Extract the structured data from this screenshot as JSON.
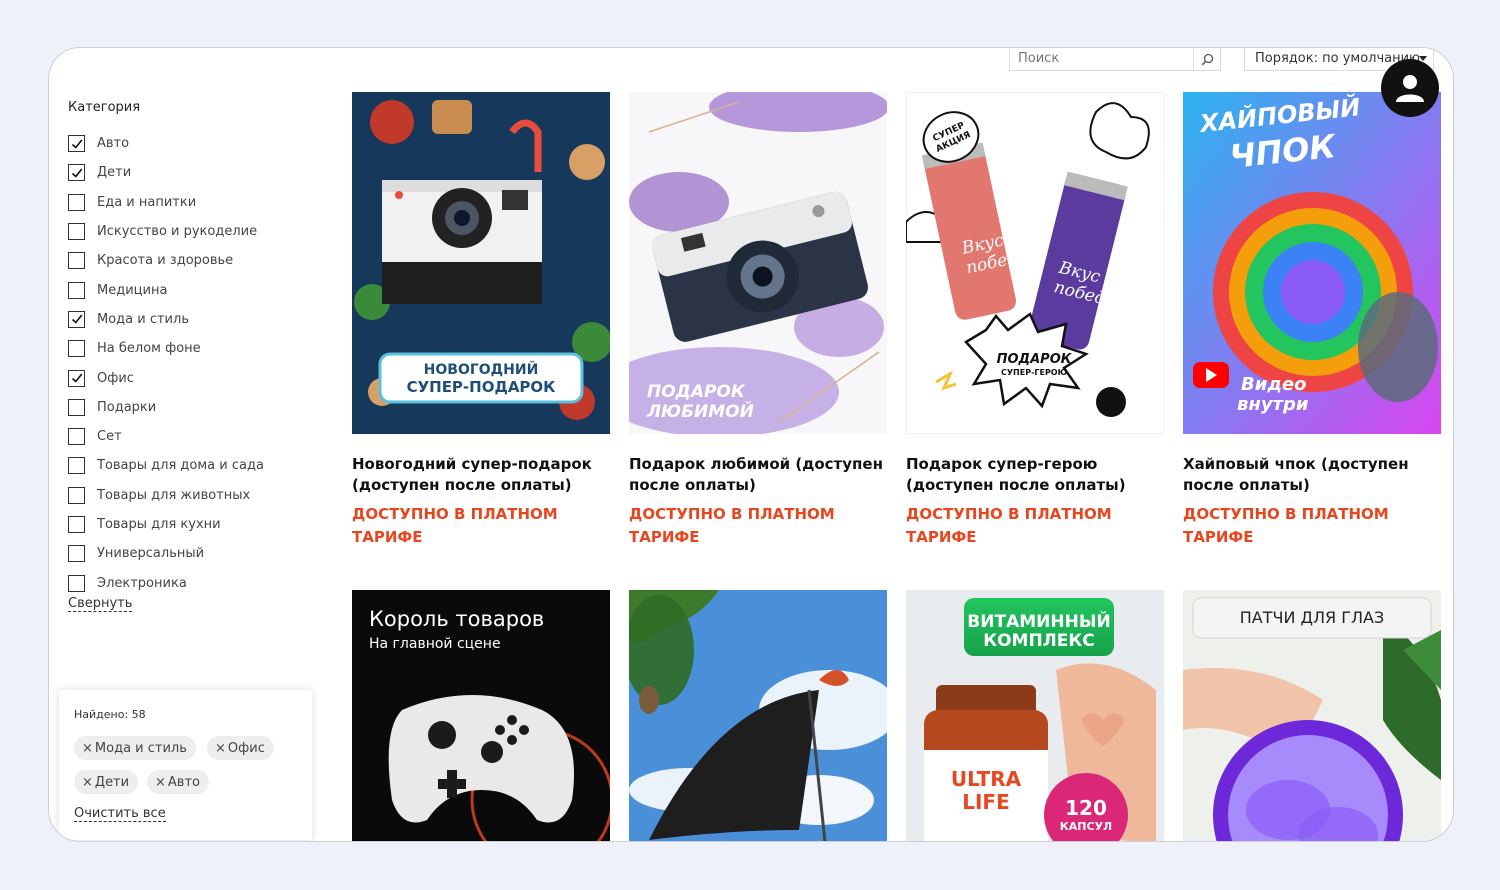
{
  "search": {
    "placeholder": "Поиск"
  },
  "sort": {
    "label": "Порядок: по умолчанию"
  },
  "sidebar": {
    "title": "Категория",
    "categories": [
      {
        "label": "Авто",
        "checked": true
      },
      {
        "label": "Дети",
        "checked": true
      },
      {
        "label": "Еда и напитки",
        "checked": false
      },
      {
        "label": "Искусство и рукоделие",
        "checked": false
      },
      {
        "label": "Красота и здоровье",
        "checked": false
      },
      {
        "label": "Медицина",
        "checked": false
      },
      {
        "label": "Мода и стиль",
        "checked": true
      },
      {
        "label": "На белом фоне",
        "checked": false
      },
      {
        "label": "Офис",
        "checked": true
      },
      {
        "label": "Подарки",
        "checked": false
      },
      {
        "label": "Сет",
        "checked": false
      },
      {
        "label": "Товары для дома и сада",
        "checked": false
      },
      {
        "label": "Товары для животных",
        "checked": false
      },
      {
        "label": "Товары для кухни",
        "checked": false
      },
      {
        "label": "Универсальный",
        "checked": false
      },
      {
        "label": "Электроника",
        "checked": false
      }
    ],
    "collapse_label": "Свернуть"
  },
  "filters": {
    "found": "Найдено: 58",
    "chips": [
      "Мода и стиль",
      "Офис",
      "Дети",
      "Авто"
    ],
    "clear_label": "Очистить все"
  },
  "products": [
    {
      "title": "Новогодний супер-подарок (доступен после оплаты)",
      "price": "Доступно в платном тарифе",
      "image_text": [
        "НОВОГОДНИЙ",
        "СУПЕР-ПОДАРОК"
      ]
    },
    {
      "title": "Подарок любимой (доступен после оплаты)",
      "price": "Доступно в платном тарифе",
      "image_text": [
        "ПОДАРОК",
        "ЛЮБИМОЙ"
      ]
    },
    {
      "title": "Подарок супер-герою (доступен после оплаты)",
      "price": "Доступно в платном тарифе",
      "image_text": [
        "СУПЕР",
        "АКЦИЯ",
        "Вкус",
        "победы",
        "ПОДАРОК",
        "СУПЕР-ГЕРОЮ"
      ]
    },
    {
      "title": "Хайповый чпок (доступен после оплаты)",
      "price": "Доступно в платном тарифе",
      "image_text": [
        "ХАЙПОВЫЙ",
        "ЧПОК",
        "Видео",
        "внутри"
      ]
    },
    {
      "image_text": [
        "Король товаров",
        "На главной сцене"
      ]
    },
    {
      "image_text": []
    },
    {
      "image_text": [
        "ВИТАМИННЫЙ",
        "КОМПЛЕКС",
        "ULTRA",
        "LIFE",
        "120",
        "КАПСУЛ"
      ]
    },
    {
      "image_text": [
        "ПАТЧИ ДЛЯ ГЛАЗ"
      ]
    }
  ],
  "colors": {
    "accent": "#e8461f",
    "frame_bg": "#eef2f8"
  }
}
